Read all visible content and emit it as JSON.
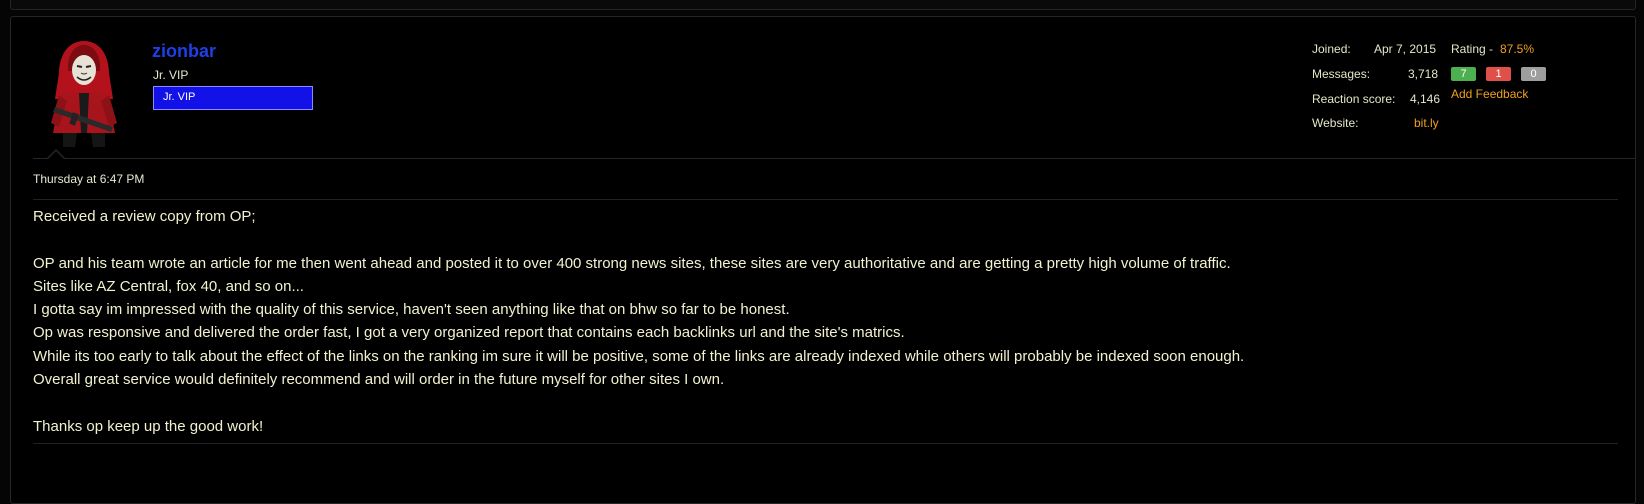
{
  "user": {
    "name": "zionbar",
    "title": "Jr. VIP",
    "banner": "Jr. VIP",
    "avatar_icon": "hooded-figure-avatar"
  },
  "stats": {
    "joined_label": "Joined:",
    "joined_value": "Apr 7, 2015",
    "messages_label": "Messages:",
    "messages_value": "3,718",
    "reaction_label": "Reaction score:",
    "reaction_value": "4,146",
    "website_label": "Website:",
    "website_value": "bit.ly"
  },
  "feedback": {
    "rating_label": "Rating -",
    "rating_pct": "87.5%",
    "positive": "7",
    "negative": "1",
    "neutral": "0",
    "add_label": "Add Feedback",
    "colors": {
      "positive": "#4caf50",
      "negative": "#e0504a",
      "neutral": "#9e9e9e"
    }
  },
  "post": {
    "date": "Thursday at 6:47 PM",
    "lines": [
      "Received a review copy from OP;",
      "",
      "OP and his team wrote an article for me then went ahead and posted it to over 400 strong news sites, these sites are very authoritative and are getting a pretty high volume of traffic.",
      "Sites like AZ Central, fox 40, and so on...",
      "I gotta say im impressed with the quality of this service, haven't seen anything like that on bhw so far to be honest.",
      "Op was responsive and delivered the order fast, I got a very organized report that contains each backlinks url and the site's matrics.",
      "While its too early to talk about the effect of the links on the ranking im sure it will be positive, some of the links are already indexed while others will probably be indexed soon enough.",
      "Overall great service would definitely recommend and will order in the future myself for other sites I own.",
      "",
      "Thanks op keep up the good work!"
    ]
  }
}
